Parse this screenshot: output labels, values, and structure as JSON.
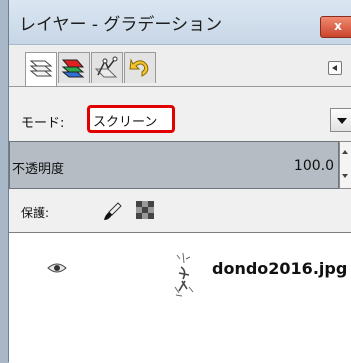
{
  "window": {
    "title": "レイヤー - グラデーション",
    "close_glyph": "x"
  },
  "tabs": [
    {
      "icon": "layers-icon"
    },
    {
      "icon": "channels-icon"
    },
    {
      "icon": "paths-icon"
    },
    {
      "icon": "undo-history-icon"
    }
  ],
  "mode": {
    "label": "モード:",
    "value": "スクリーン"
  },
  "opacity": {
    "label": "不透明度",
    "value": "100.0"
  },
  "lock": {
    "label": "保護:"
  },
  "layers": [
    {
      "name": "dondo2016.jpg",
      "visible": true
    }
  ]
}
